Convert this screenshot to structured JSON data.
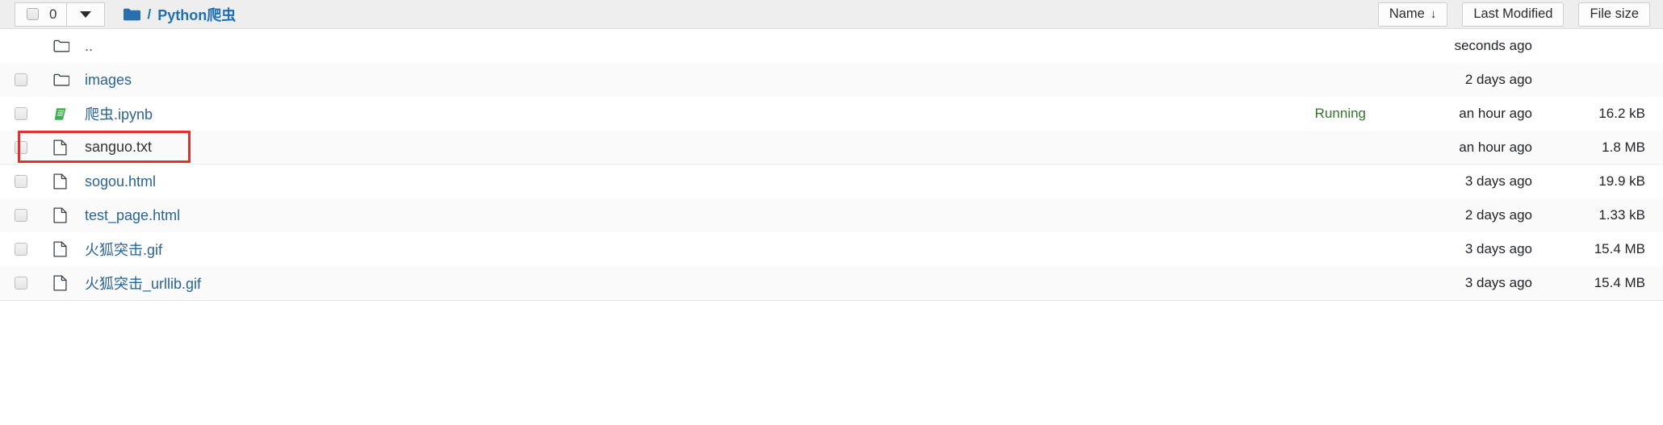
{
  "toolbar": {
    "select_all_checkbox": "select-all-checkbox",
    "selected_count": "0",
    "dropdown_caret": "chevron-down-icon",
    "breadcrumb": {
      "root_icon": "folder-icon",
      "separator": "/",
      "current": "Python爬虫"
    },
    "sort_buttons": [
      {
        "label": "Name",
        "arrow": "↓",
        "active": true
      },
      {
        "label": "Last Modified",
        "arrow": "",
        "active": false
      },
      {
        "label": "File size",
        "arrow": "",
        "active": false
      }
    ]
  },
  "rows": [
    {
      "name": "..",
      "icon": "folder-icon",
      "icon_kind": "folder",
      "status": "",
      "modified": "seconds ago",
      "size": "",
      "checkbox": false,
      "link": true,
      "highlighted": false
    },
    {
      "name": "images",
      "icon": "folder-icon",
      "icon_kind": "folder",
      "status": "",
      "modified": "2 days ago",
      "size": "",
      "checkbox": true,
      "link": true,
      "highlighted": false
    },
    {
      "name": "爬虫.ipynb",
      "icon": "notebook-icon",
      "icon_kind": "notebook",
      "status": "Running",
      "modified": "an hour ago",
      "size": "16.2 kB",
      "checkbox": true,
      "link": true,
      "highlighted": false
    },
    {
      "name": "sanguo.txt",
      "icon": "file-icon",
      "icon_kind": "file",
      "status": "",
      "modified": "an hour ago",
      "size": "1.8 MB",
      "checkbox": true,
      "link": false,
      "highlighted": true
    },
    {
      "name": "sogou.html",
      "icon": "file-icon",
      "icon_kind": "file",
      "status": "",
      "modified": "3 days ago",
      "size": "19.9 kB",
      "checkbox": true,
      "link": true,
      "highlighted": false
    },
    {
      "name": "test_page.html",
      "icon": "file-icon",
      "icon_kind": "file",
      "status": "",
      "modified": "2 days ago",
      "size": "1.33 kB",
      "checkbox": true,
      "link": true,
      "highlighted": false
    },
    {
      "name": "火狐突击.gif",
      "icon": "file-icon",
      "icon_kind": "file",
      "status": "",
      "modified": "3 days ago",
      "size": "15.4 MB",
      "checkbox": true,
      "link": true,
      "highlighted": false
    },
    {
      "name": "火狐突击_urllib.gif",
      "icon": "file-icon",
      "icon_kind": "file",
      "status": "",
      "modified": "3 days ago",
      "size": "15.4 MB",
      "checkbox": true,
      "link": true,
      "highlighted": false
    }
  ],
  "colors": {
    "link": "#2a6496",
    "breadcrumb": "#1f6fb2",
    "running": "#36752d",
    "annotation": "#e03131",
    "toolbar_bg": "#eeeeee",
    "row_alt_bg": "#fafafa"
  }
}
